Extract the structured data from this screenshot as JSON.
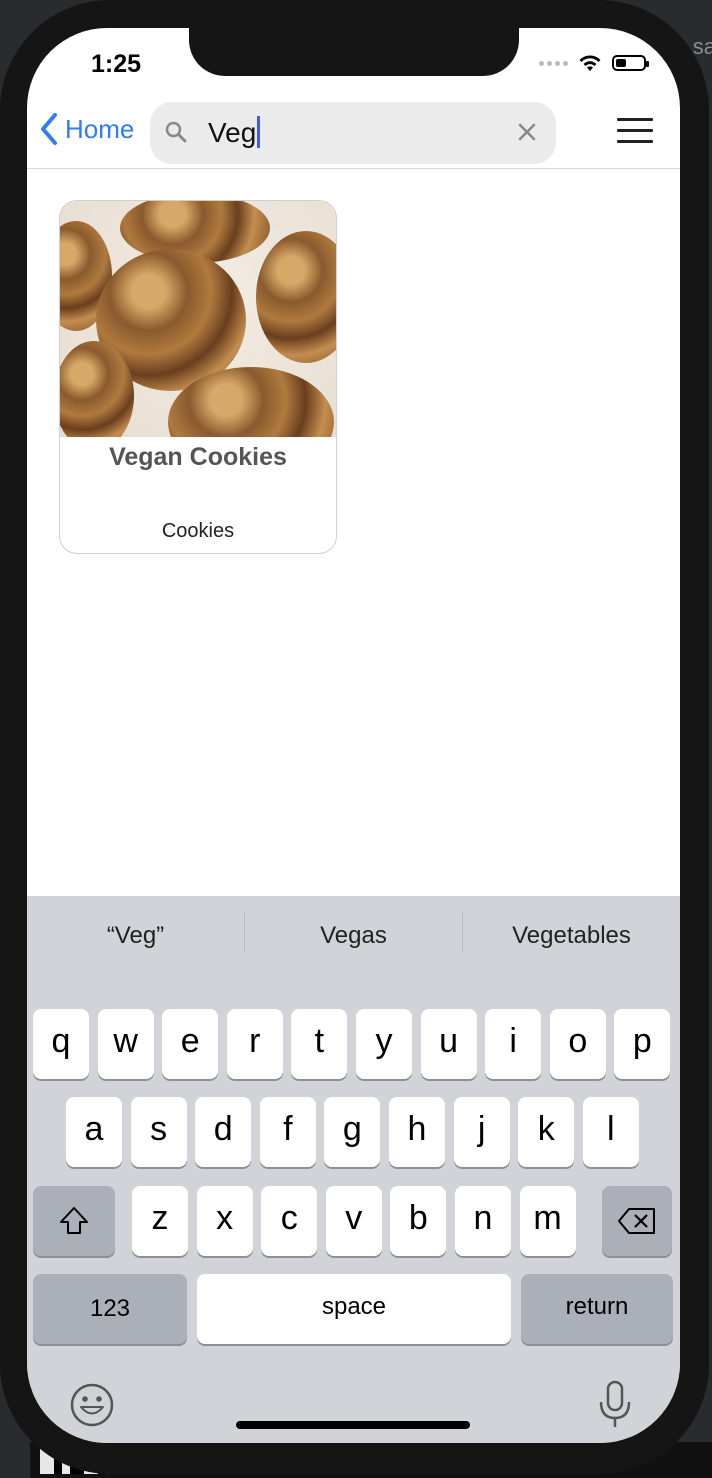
{
  "status_bar": {
    "time": "1:25"
  },
  "nav": {
    "back_label": "Home",
    "search_value": "Veg"
  },
  "results": [
    {
      "title": "Vegan Cookies",
      "category": "Cookies"
    }
  ],
  "keyboard": {
    "suggestions": [
      "“Veg”",
      "Vegas",
      "Vegetables"
    ],
    "row1": [
      "q",
      "w",
      "e",
      "r",
      "t",
      "y",
      "u",
      "i",
      "o",
      "p"
    ],
    "row2": [
      "a",
      "s",
      "d",
      "f",
      "g",
      "h",
      "j",
      "k",
      "l"
    ],
    "row3": [
      "z",
      "x",
      "c",
      "v",
      "b",
      "n",
      "m"
    ],
    "numbers_label": "123",
    "space_label": "space",
    "return_label": "return"
  },
  "colors": {
    "accent": "#2f7cf6",
    "keyboard_bg": "#d1d3d8"
  }
}
